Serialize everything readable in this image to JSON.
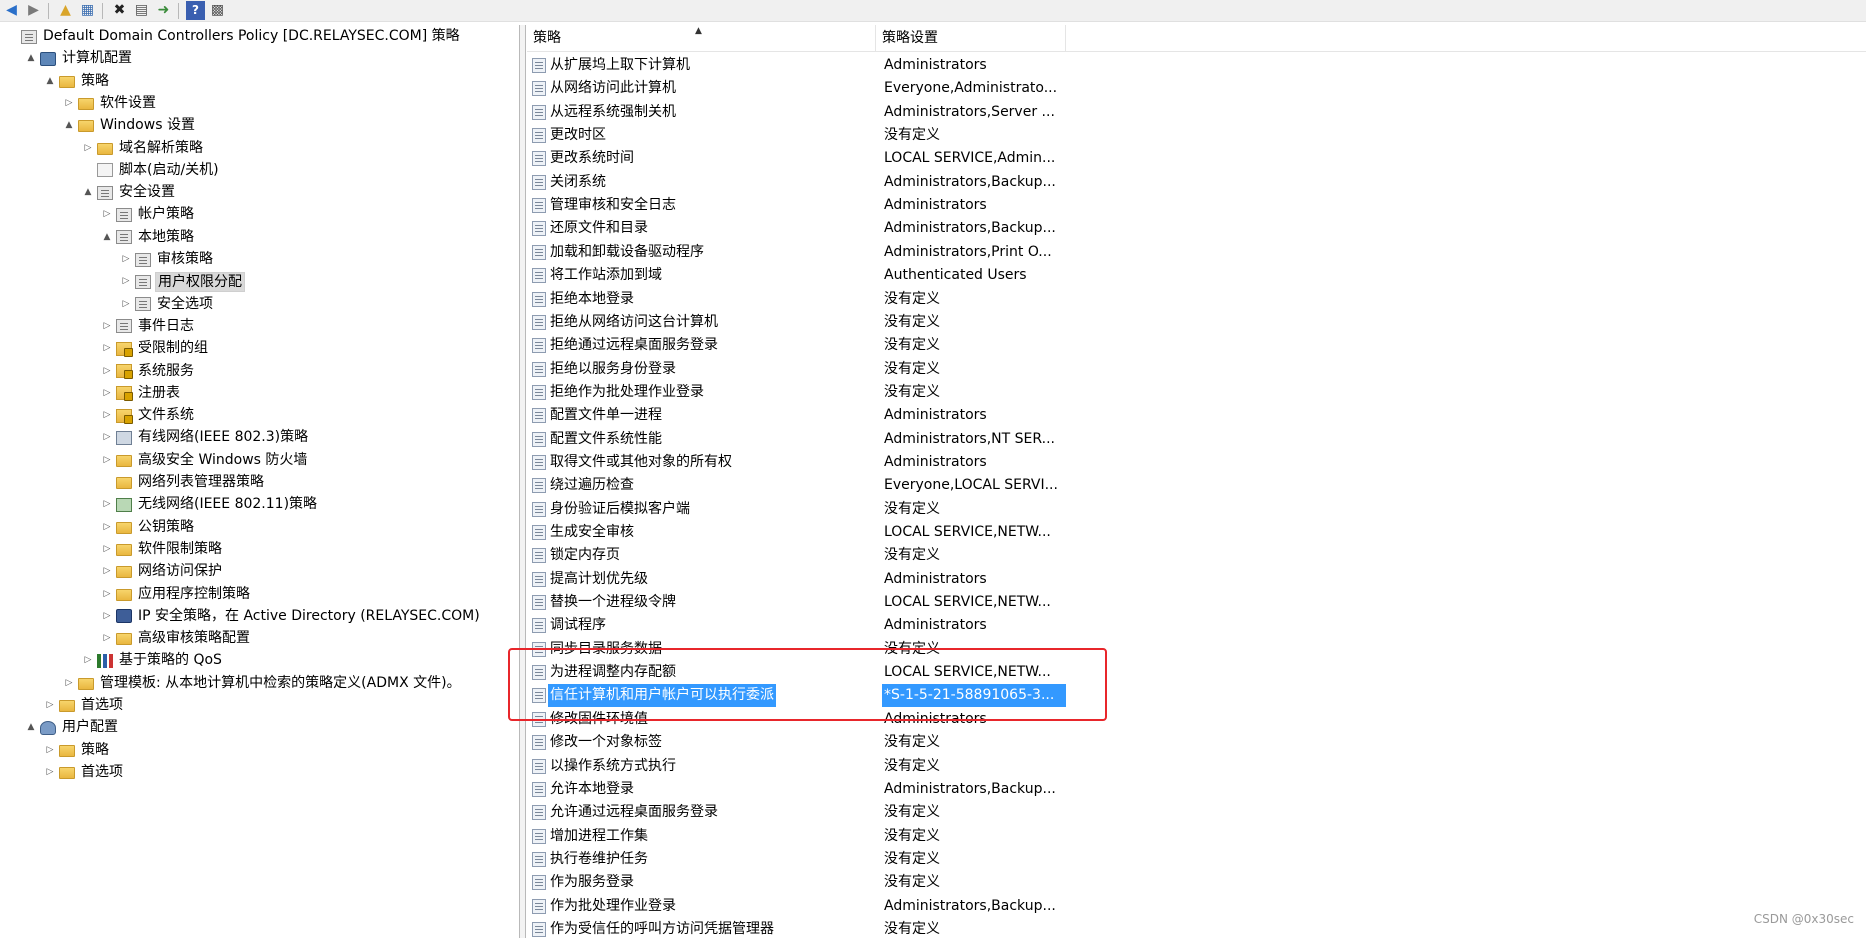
{
  "toolbar": {
    "buttons": [
      "back-arrow-icon",
      "forward-arrow-icon",
      "up-folder-icon",
      "show-hide-tree-icon",
      "delete-icon",
      "properties-icon",
      "export-icon",
      "help-icon",
      "view-icon"
    ]
  },
  "tree": {
    "items": [
      {
        "label": "Default Domain Controllers Policy [DC.RELAYSEC.COM] 策略",
        "icon": "policy-icon",
        "expander": ""
      },
      {
        "label": "计算机配置",
        "icon": "computer-icon",
        "expander": "▲"
      },
      {
        "label": "策略",
        "icon": "folder-icon",
        "expander": "▲"
      },
      {
        "label": "软件设置",
        "icon": "folder-icon",
        "expander": "▷"
      },
      {
        "label": "Windows 设置",
        "icon": "folder-icon",
        "expander": "▲"
      },
      {
        "label": "域名解析策略",
        "icon": "folder-icon",
        "expander": "▷"
      },
      {
        "label": "脚本(启动/关机)",
        "icon": "script-icon",
        "expander": ""
      },
      {
        "label": "安全设置",
        "icon": "policy-icon",
        "expander": "▲"
      },
      {
        "label": "帐户策略",
        "icon": "policy-icon",
        "expander": "▷"
      },
      {
        "label": "本地策略",
        "icon": "policy-icon",
        "expander": "▲"
      },
      {
        "label": "审核策略",
        "icon": "policy-icon",
        "expander": "▷"
      },
      {
        "label": "用户权限分配",
        "icon": "policy-icon",
        "expander": "▷"
      },
      {
        "label": "安全选项",
        "icon": "policy-icon",
        "expander": "▷"
      },
      {
        "label": "事件日志",
        "icon": "policy-icon",
        "expander": "▷"
      },
      {
        "label": "受限制的组",
        "icon": "lock-folder-icon",
        "expander": "▷"
      },
      {
        "label": "系统服务",
        "icon": "lock-folder-icon",
        "expander": "▷"
      },
      {
        "label": "注册表",
        "icon": "lock-folder-icon",
        "expander": "▷"
      },
      {
        "label": "文件系统",
        "icon": "lock-folder-icon",
        "expander": "▷"
      },
      {
        "label": "有线网络(IEEE 802.3)策略",
        "icon": "network-icon",
        "expander": "▷"
      },
      {
        "label": "高级安全 Windows 防火墙",
        "icon": "folder-icon",
        "expander": "▷"
      },
      {
        "label": "网络列表管理器策略",
        "icon": "folder-icon",
        "expander": ""
      },
      {
        "label": "无线网络(IEEE 802.11)策略",
        "icon": "wireless-icon",
        "expander": "▷"
      },
      {
        "label": "公钥策略",
        "icon": "folder-icon",
        "expander": "▷"
      },
      {
        "label": "软件限制策略",
        "icon": "folder-icon",
        "expander": "▷"
      },
      {
        "label": "网络访问保护",
        "icon": "folder-icon",
        "expander": "▷"
      },
      {
        "label": "应用程序控制策略",
        "icon": "folder-icon",
        "expander": "▷"
      },
      {
        "label": "IP 安全策略，在 Active Directory (RELAYSEC.COM)",
        "icon": "ipsec-icon",
        "expander": "▷"
      },
      {
        "label": "高级审核策略配置",
        "icon": "folder-icon",
        "expander": "▷"
      },
      {
        "label": "基于策略的 QoS",
        "icon": "qos-icon",
        "expander": "▷"
      },
      {
        "label": "管理模板: 从本地计算机中检索的策略定义(ADMX 文件)。",
        "icon": "folder-icon",
        "expander": "▷"
      },
      {
        "label": "首选项",
        "icon": "folder-icon",
        "expander": "▷"
      },
      {
        "label": "用户配置",
        "icon": "user-icon",
        "expander": "▲"
      },
      {
        "label": "策略",
        "icon": "folder-icon",
        "expander": "▷"
      },
      {
        "label": "首选项",
        "icon": "folder-icon",
        "expander": "▷"
      }
    ]
  },
  "list": {
    "columns": [
      "策略",
      "策略设置"
    ],
    "rows": [
      {
        "policy": "从扩展坞上取下计算机",
        "setting": "Administrators"
      },
      {
        "policy": "从网络访问此计算机",
        "setting": "Everyone,Administrato..."
      },
      {
        "policy": "从远程系统强制关机",
        "setting": "Administrators,Server ..."
      },
      {
        "policy": "更改时区",
        "setting": "没有定义"
      },
      {
        "policy": "更改系统时间",
        "setting": "LOCAL SERVICE,Admin..."
      },
      {
        "policy": "关闭系统",
        "setting": "Administrators,Backup..."
      },
      {
        "policy": "管理审核和安全日志",
        "setting": "Administrators"
      },
      {
        "policy": "还原文件和目录",
        "setting": "Administrators,Backup..."
      },
      {
        "policy": "加载和卸载设备驱动程序",
        "setting": "Administrators,Print O..."
      },
      {
        "policy": "将工作站添加到域",
        "setting": "Authenticated Users"
      },
      {
        "policy": "拒绝本地登录",
        "setting": "没有定义"
      },
      {
        "policy": "拒绝从网络访问这台计算机",
        "setting": "没有定义"
      },
      {
        "policy": "拒绝通过远程桌面服务登录",
        "setting": "没有定义"
      },
      {
        "policy": "拒绝以服务身份登录",
        "setting": "没有定义"
      },
      {
        "policy": "拒绝作为批处理作业登录",
        "setting": "没有定义"
      },
      {
        "policy": "配置文件单一进程",
        "setting": "Administrators"
      },
      {
        "policy": "配置文件系统性能",
        "setting": "Administrators,NT SER..."
      },
      {
        "policy": "取得文件或其他对象的所有权",
        "setting": "Administrators"
      },
      {
        "policy": "绕过遍历检查",
        "setting": "Everyone,LOCAL SERVI..."
      },
      {
        "policy": "身份验证后模拟客户端",
        "setting": "没有定义"
      },
      {
        "policy": "生成安全审核",
        "setting": "LOCAL SERVICE,NETW..."
      },
      {
        "policy": "锁定内存页",
        "setting": "没有定义"
      },
      {
        "policy": "提高计划优先级",
        "setting": "Administrators"
      },
      {
        "policy": "替换一个进程级令牌",
        "setting": "LOCAL SERVICE,NETW..."
      },
      {
        "policy": "调试程序",
        "setting": "Administrators"
      },
      {
        "policy": "同步目录服务数据",
        "setting": "没有定义"
      },
      {
        "policy": "为进程调整内存配额",
        "setting": "LOCAL SERVICE,NETW..."
      },
      {
        "policy": "信任计算机和用户帐户可以执行委派",
        "setting": "*S-1-5-21-58891065-3..."
      },
      {
        "policy": "修改固件环境值",
        "setting": "Administrators"
      },
      {
        "policy": "修改一个对象标签",
        "setting": "没有定义"
      },
      {
        "policy": "以操作系统方式执行",
        "setting": "没有定义"
      },
      {
        "policy": "允许本地登录",
        "setting": "Administrators,Backup..."
      },
      {
        "policy": "允许通过远程桌面服务登录",
        "setting": "没有定义"
      },
      {
        "policy": "增加进程工作集",
        "setting": "没有定义"
      },
      {
        "policy": "执行卷维护任务",
        "setting": "没有定义"
      },
      {
        "policy": "作为服务登录",
        "setting": "没有定义"
      },
      {
        "policy": "作为批处理作业登录",
        "setting": "Administrators,Backup..."
      },
      {
        "policy": "作为受信任的呼叫方访问凭据管理器",
        "setting": "没有定义"
      }
    ]
  },
  "colors": {
    "selection": "#3399ff",
    "annotation_box": "#e8262b"
  },
  "watermark": "CSDN @0x30sec"
}
